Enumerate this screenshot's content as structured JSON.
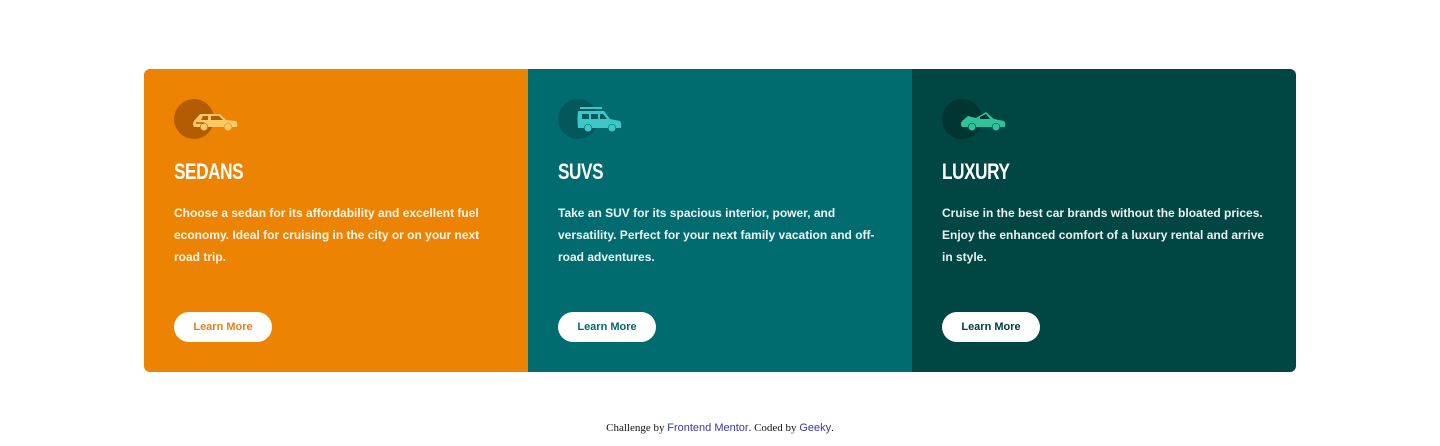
{
  "cards": [
    {
      "title": "SEDANS",
      "description": "Choose a sedan for its affordability and excellent fuel economy. Ideal for cruising in the city or on your next road trip.",
      "button_label": "Learn More",
      "icon": "sedan-car-icon",
      "color": "#ed8303"
    },
    {
      "title": "SUVS",
      "description": "Take an SUV for its spacious interior, power, and versatility. Perfect for your next family vacation and off-road adventures.",
      "button_label": "Learn More",
      "icon": "suv-car-icon",
      "color": "#016c70"
    },
    {
      "title": "LUXURY",
      "description": "Cruise in the best car brands without the bloated prices. Enjoy the enhanced comfort of a luxury rental and arrive in style.",
      "button_label": "Learn More",
      "icon": "luxury-car-icon",
      "color": "#004643"
    }
  ],
  "footer": {
    "prefix": "Challenge by ",
    "link1": "Frontend Mentor",
    "middle": ". Coded by ",
    "link2": "Geeky",
    "suffix": "."
  }
}
